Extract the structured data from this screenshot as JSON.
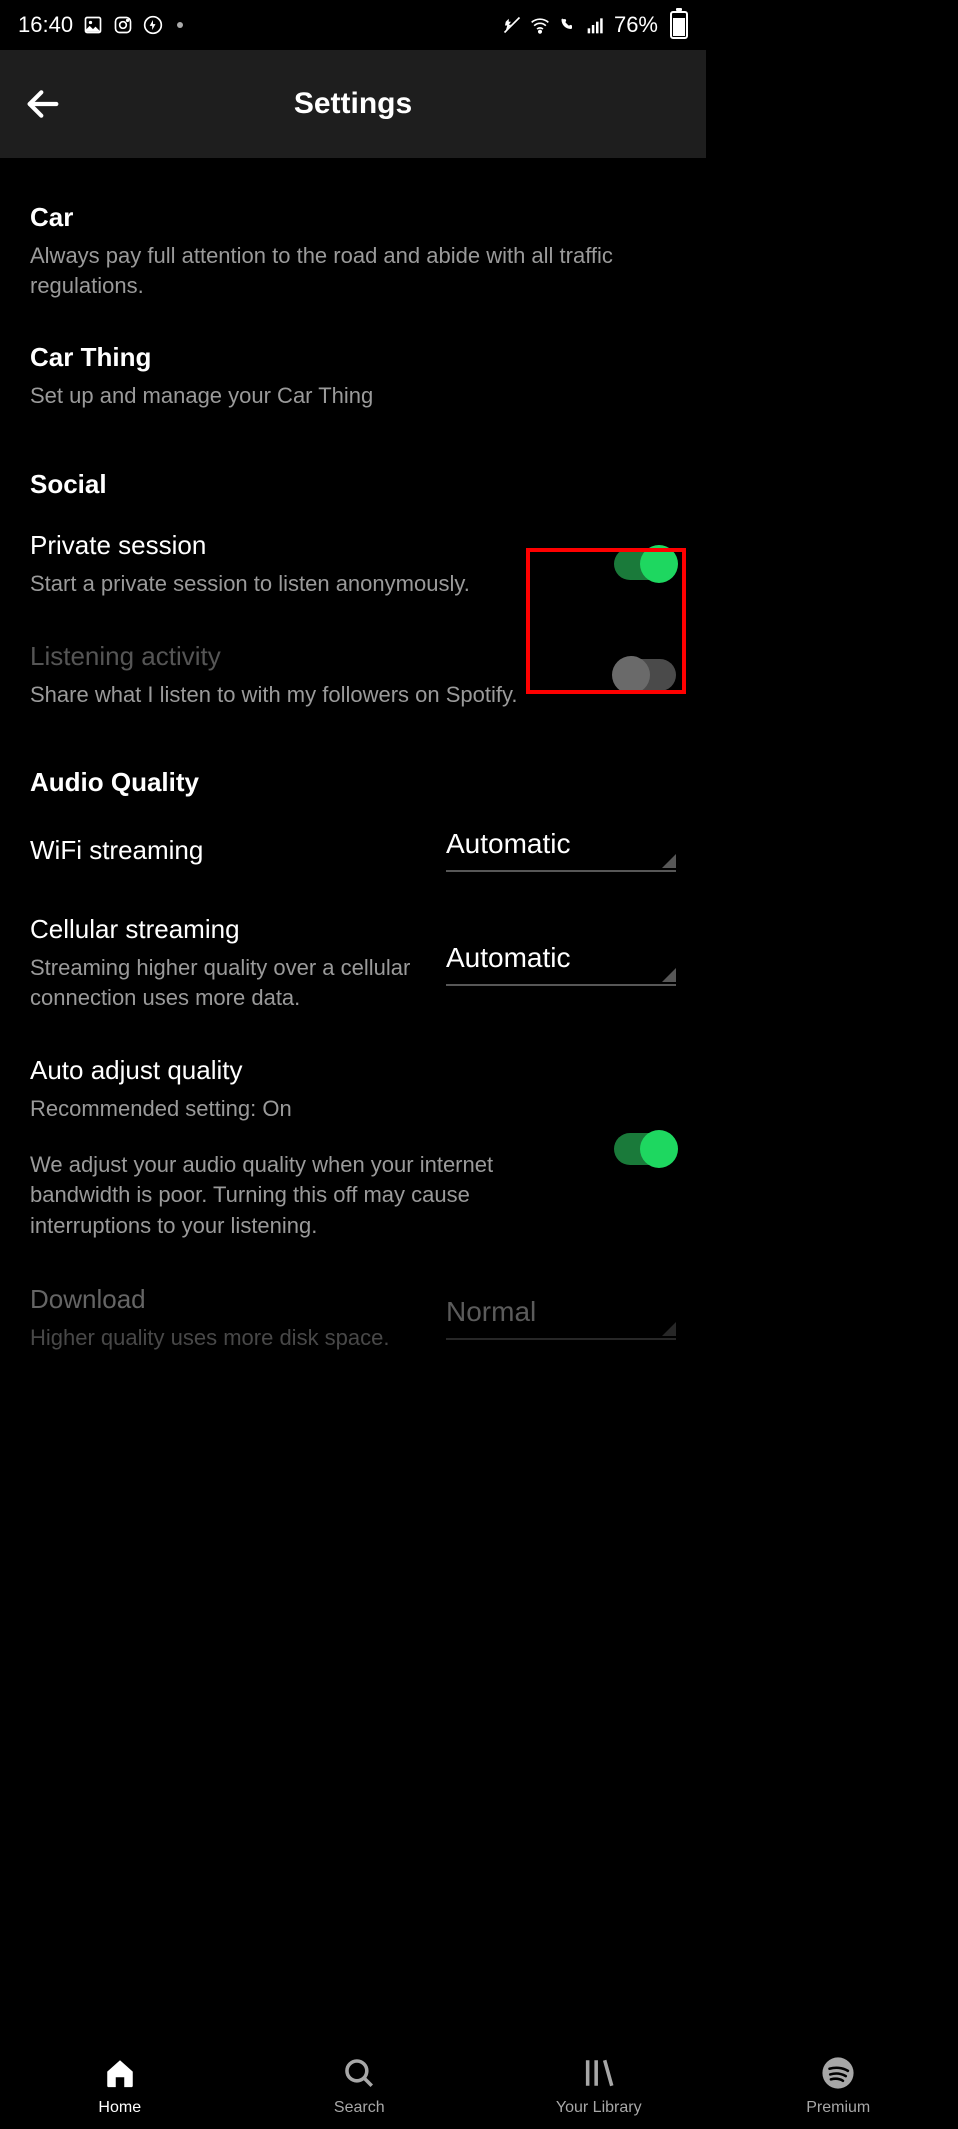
{
  "status": {
    "time": "16:40",
    "battery_pct": "76%"
  },
  "header": {
    "title": "Settings"
  },
  "items": {
    "car": {
      "title": "Car",
      "sub": "Always pay full attention to the road and abide with all traffic regulations."
    },
    "car_thing": {
      "title": "Car Thing",
      "sub": "Set up and manage your Car Thing"
    },
    "social_header": "Social",
    "private_session": {
      "title": "Private session",
      "sub": "Start a private session to listen anonymously.",
      "on": true
    },
    "listening_activity": {
      "title": "Listening activity",
      "sub": "Share what I listen to with my followers on Spotify.",
      "on": false
    },
    "audio_header": "Audio Quality",
    "wifi_streaming": {
      "title": "WiFi streaming",
      "value": "Automatic"
    },
    "cellular_streaming": {
      "title": "Cellular streaming",
      "sub": "Streaming higher quality over a cellular connection uses more data.",
      "value": "Automatic"
    },
    "auto_adjust": {
      "title": "Auto adjust quality",
      "sub": "Recommended setting: On",
      "extra": "We adjust your audio quality when your internet bandwidth is poor. Turning this off may cause interruptions to your listening.",
      "on": true
    },
    "download": {
      "title": "Download",
      "sub": "Higher quality uses more disk space.",
      "value": "Normal"
    }
  },
  "nav": {
    "home": "Home",
    "search": "Search",
    "library": "Your Library",
    "premium": "Premium"
  }
}
